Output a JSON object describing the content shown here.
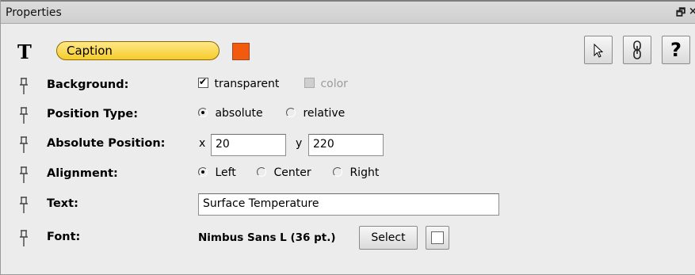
{
  "panel": {
    "title": "Properties",
    "restore_glyph": "🗗",
    "close_glyph": "×"
  },
  "header": {
    "type_icon": "text-type-icon",
    "caption_label": "Caption",
    "color_swatch": "#f15a0f",
    "tools": [
      {
        "name": "pointer-tool-button",
        "icon": "cursor-arrow-icon"
      },
      {
        "name": "link-tool-button",
        "icon": "chain-link-icon"
      },
      {
        "name": "help-button",
        "icon": "question-icon",
        "glyph": "?"
      }
    ]
  },
  "rows": {
    "background": {
      "label": "Background:",
      "transparent_label": "transparent",
      "transparent_checked": true,
      "color_label": "color"
    },
    "position_type": {
      "label": "Position Type:",
      "options": [
        "absolute",
        "relative"
      ],
      "selected": "absolute"
    },
    "absolute_position": {
      "label": "Absolute Position:",
      "x_label": "x",
      "x_value": "20",
      "y_label": "y",
      "y_value": "220"
    },
    "alignment": {
      "label": "Alignment:",
      "options": [
        "Left",
        "Center",
        "Right"
      ],
      "selected": "Left"
    },
    "text": {
      "label": "Text:",
      "value": "Surface Temperature"
    },
    "font": {
      "label": "Font:",
      "value": "Nimbus Sans L (36 pt.)",
      "select_label": "Select"
    }
  }
}
